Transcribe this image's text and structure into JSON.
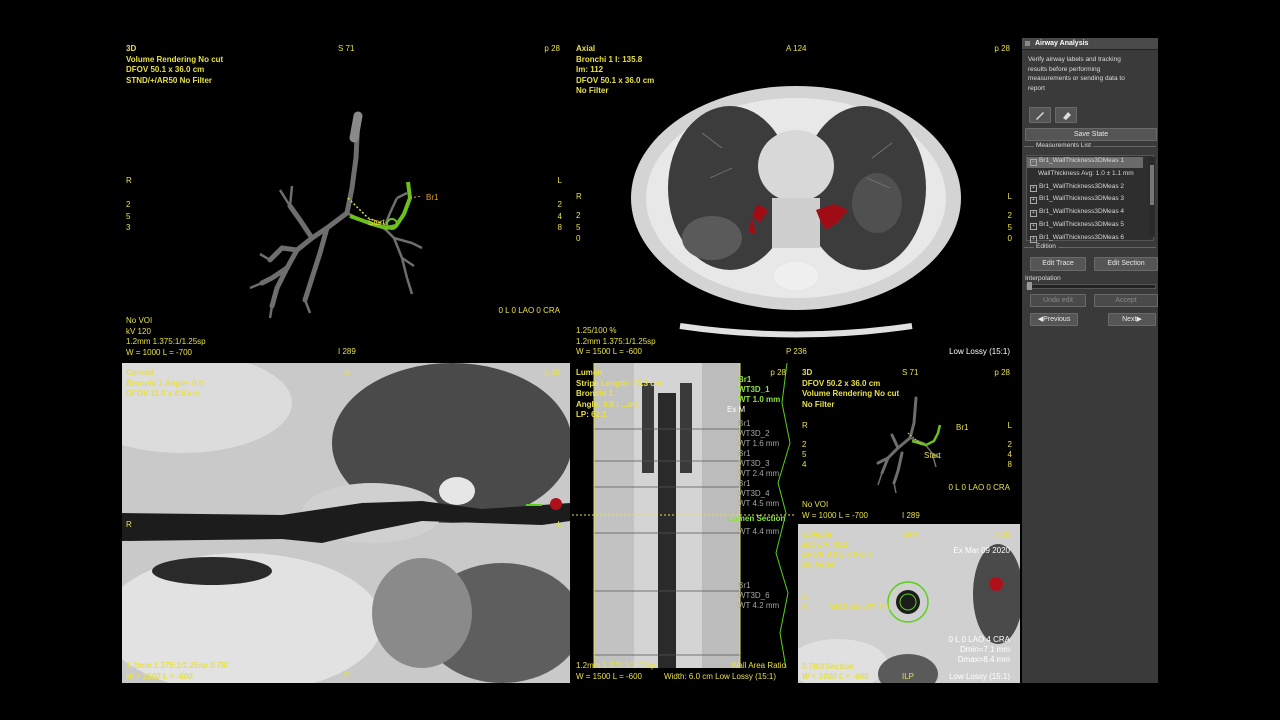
{
  "colors": {
    "overlay": "#e7e04a",
    "green": "#8ee04a",
    "bronchus_mask": "#b0101a",
    "panel_bg": "#3a3a3a"
  },
  "vp3d": {
    "tl": [
      "3D",
      "Volume Rendering No cut",
      "DFOV 50.1 x 36.0 cm",
      "STND/+/AR50 No Filter"
    ],
    "top": "S 71",
    "tr": "p 28",
    "left_r": "R",
    "right_l": "L",
    "left_nums": [
      "2",
      "5",
      "3"
    ],
    "right_nums": [
      "2",
      "4",
      "8"
    ],
    "bl": [
      "No VOI",
      "kV 120",
      "1.2mm 1.375:1/1.25sp",
      "W = 1000 L = -700"
    ],
    "bottom": "I 289",
    "br": "0 L 0 LAO 0 CRA",
    "label_br1": "Br1",
    "label_start": "Start"
  },
  "axial": {
    "tl": [
      "Axial",
      "Bronchi 1 I: 135.8",
      "Im: 112",
      "DFOV 50.1 x 36.0 cm",
      "No Filter"
    ],
    "top": "A 124",
    "tr": "p 28",
    "left_r": "R",
    "right_l": "L",
    "left_nums": [
      "2",
      "5",
      "0"
    ],
    "right_nums": [
      "2",
      "5",
      "0"
    ],
    "bl": [
      "1.25/100 %",
      "1.2mm 1.375:1/1.25sp",
      "W = 1500 L = -600"
    ],
    "bottom": "P 236",
    "br": "Low Lossy (15:1)"
  },
  "curved": {
    "tl": [
      "Curved",
      "Bronchi 1 Angle: 0.0",
      "DFOV 11.0 x 8.6 cm"
    ],
    "top": "A",
    "tr": "p 28",
    "left_r": "R",
    "right_l": "L",
    "bl": [
      "1.2mm 1.375:1/1.25sp 0.78/",
      "W = 1500 L = -600"
    ],
    "bottom": "P"
  },
  "lumen": {
    "tl": [
      "Lumen",
      "Stripe Length: 13.3 cm",
      "Bronchi 1",
      "Angle: 0.0 / ...mt",
      "LP: 62.1"
    ],
    "tr": "p 28",
    "labels": [
      "Br1",
      "WT3D_1",
      "WT 1.0 mm",
      "Br1",
      "WT3D_2",
      "WT 1.6 mm",
      "Br1",
      "WT3D_3",
      "WT 2.4 mm",
      "Br1",
      "WT3D_4",
      "WT 4.5 mm",
      "Lumen Section",
      "WT 4.4 mm",
      "Br1",
      "WT3D_6",
      "WT 4.2 mm"
    ],
    "ex": "Ex M",
    "bl": [
      "1.2mm 1.375:1/1.25sp",
      "W = 1500 L = -600"
    ],
    "bottom": "Width: 6.0 cm Low Lossy (15:1)",
    "br_top": "Wall Area Ratio"
  },
  "small3d": {
    "tl": [
      "3D",
      "DFOV 50.2 x 36.0 cm",
      "Volume Rendering No cut",
      "No Filter"
    ],
    "top": "S 71",
    "tr": "p 28",
    "left_r": "R",
    "right_l": "L",
    "left_nums": [
      "2",
      "5",
      "4"
    ],
    "right_nums": [
      "2",
      "4",
      "8"
    ],
    "bl": [
      "No VOI",
      "W = 1000 L = -700"
    ],
    "bottom": "I 289",
    "br": "0 L 0 LAO 0 CRA",
    "label_br1": "Br1",
    "label_start": "Start"
  },
  "oblique": {
    "tl": [
      "Oblique",
      "Br1 LP: 62.1",
      "DFOV 9.0 x 7.0 cm",
      "No Filter"
    ],
    "top": "SRA",
    "tr": "p 28",
    "date": "Ex Mar 09 2020",
    "left": [
      "A",
      "R"
    ],
    "ratio": "WARatio=79.1%",
    "br": [
      "0 L 0 LAO 4 CRA",
      "Dmin=7.1 mm",
      "Dmax=8.4 mm"
    ],
    "bl": [
      "0.78/XSection",
      "W = 1000 L = -600"
    ],
    "bottom": "ILP",
    "br2": "Low Lossy (15:1)"
  },
  "panel": {
    "title": "Airway Analysis",
    "instructions": "Verify airway labels and tracking\nresults before performing\nmeasurements or sending data to\nreport",
    "tool_icons": [
      "pencil-icon",
      "eraser-icon"
    ],
    "save_state": "Save State",
    "measurements_header": "Measurements List",
    "measurements": [
      {
        "label": "Br1_WallThickness3DMeas 1",
        "mark": "−",
        "selected": true
      },
      {
        "label": "WallThickness Avg: 1.0 ± 1.1 mm",
        "mark": "",
        "sub": true
      },
      {
        "label": "Br1_WallThickness3DMeas 2",
        "mark": "+"
      },
      {
        "label": "Br1_WallThickness3DMeas 3",
        "mark": "+"
      },
      {
        "label": "Br1_WallThickness3DMeas 4",
        "mark": "+"
      },
      {
        "label": "Br1_WallThickness3DMeas 5",
        "mark": "+"
      },
      {
        "label": "Br1_WallThickness3DMeas 6",
        "mark": "+"
      }
    ],
    "edition_header": "Edition",
    "edit_trace": "Edit Trace",
    "edit_section": "Edit Section",
    "interpolation": "Interpolation",
    "interpolation_value": 0.0,
    "undo_edit": "Undo edit",
    "accept": "Accept",
    "previous": "Previous",
    "next": "Next"
  }
}
